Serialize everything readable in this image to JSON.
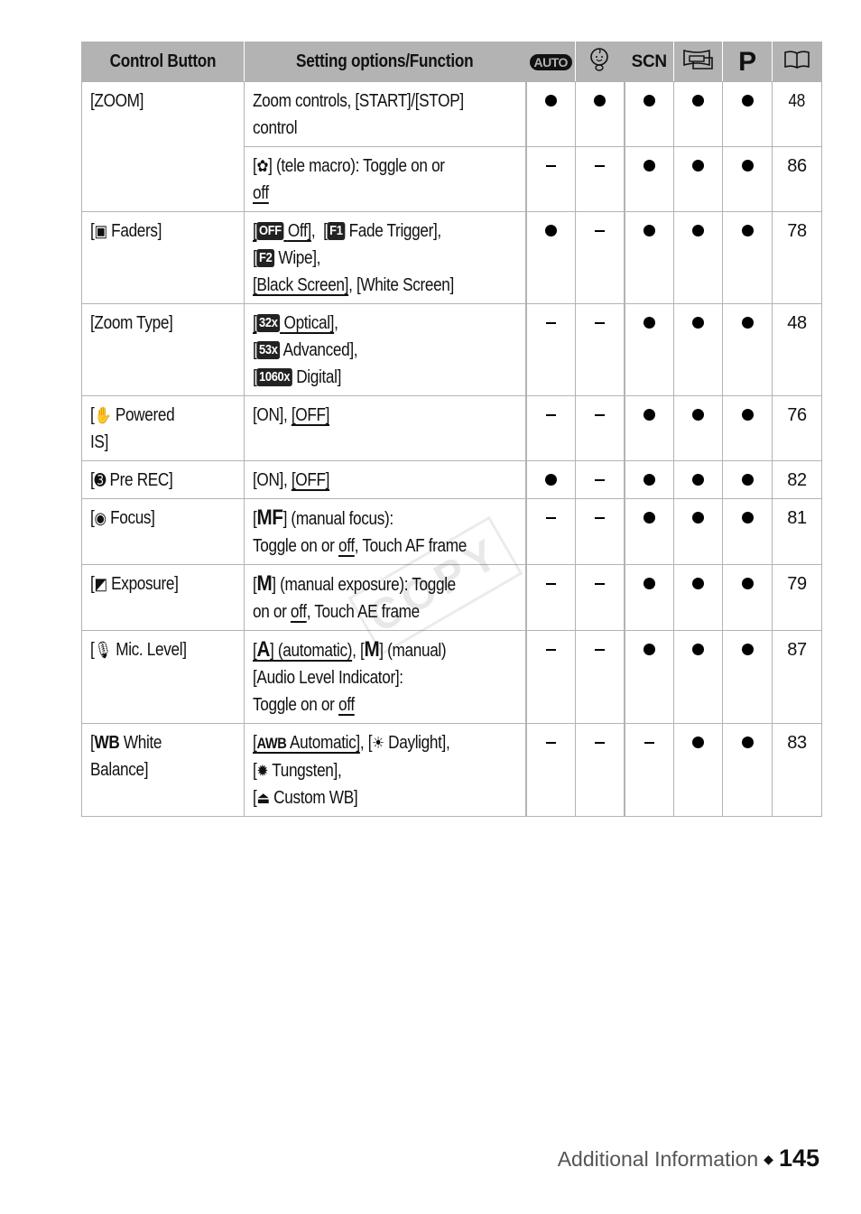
{
  "table": {
    "headers": {
      "control_button": "Control Button",
      "setting": "Setting options/Function",
      "mode_auto": "AUTO",
      "mode_baby": "baby-mode-icon",
      "mode_scn": "SCN",
      "mode_cine": "cinema-mode-icon",
      "mode_p": "P",
      "page_ref": "book-icon"
    },
    "rows": [
      {
        "control": "[ZOOM]",
        "setting_line1": "Zoom controls, [START]/[STOP]",
        "setting_line2": "control",
        "marks": [
          "●",
          "●",
          "●",
          "●",
          "●"
        ],
        "page": "48"
      },
      {
        "control": "",
        "setting_pre": "[",
        "setting_icon": "tele-macro-icon",
        "setting_line1": "] (tele macro): Toggle on or",
        "setting_line2": "off",
        "marks": [
          "–",
          "–",
          "●",
          "●",
          "●"
        ],
        "page": "86"
      },
      {
        "control": "Faders]",
        "control_icon": "faders-icon",
        "options": [
          "OFF Off",
          "F1 Fade Trigger",
          "F2 Wipe",
          "Black Screen",
          "White Screen"
        ],
        "badges": {
          "off": "OFF",
          "f1": "F1",
          "f2": "F2"
        },
        "labels": {
          "off": "Off]",
          "f1": "Fade Trigger],",
          "f2": "Wipe],",
          "black": "[Black Screen]",
          "white": ", [White Screen]"
        },
        "marks": [
          "●",
          "–",
          "●",
          "●",
          "●"
        ],
        "page": "78"
      },
      {
        "control": "[Zoom Type]",
        "badges": {
          "optical": "32x",
          "advanced": "53x",
          "digital": "1060x"
        },
        "labels": {
          "optical": "Optical]",
          "advanced": "Advanced],",
          "digital": "Digital]"
        },
        "marks": [
          "–",
          "–",
          "●",
          "●",
          "●"
        ],
        "page": "48"
      },
      {
        "control_line1": "Powered",
        "control_line2": "IS]",
        "control_icon": "powered-is-icon",
        "setting_on": "[ON], ",
        "setting_off": "[OFF]",
        "marks": [
          "–",
          "–",
          "●",
          "●",
          "●"
        ],
        "page": "76"
      },
      {
        "control": "Pre REC]",
        "control_icon": "pre-rec-icon",
        "setting_on": "[ON], ",
        "setting_off": "[OFF]",
        "marks": [
          "●",
          "–",
          "●",
          "●",
          "●"
        ],
        "page": "82"
      },
      {
        "control": "Focus]",
        "control_icon": "focus-icon",
        "badge": "MF",
        "setting_line1": "] (manual focus):",
        "setting_line2a": "Toggle on or ",
        "setting_line2b": "off",
        "setting_line2c": ", Touch AF frame",
        "marks": [
          "–",
          "–",
          "●",
          "●",
          "●"
        ],
        "page": "81"
      },
      {
        "control": "Exposure]",
        "control_icon": "exposure-icon",
        "badge": "M",
        "setting_line1": "] (manual exposure): Toggle",
        "setting_line2a": "on or ",
        "setting_line2b": "off",
        "setting_line2c": ", Touch AE frame",
        "marks": [
          "–",
          "–",
          "●",
          "●",
          "●"
        ],
        "page": "79"
      },
      {
        "control": "Mic. Level]",
        "control_icon": "microphone-icon",
        "badge_a": "A",
        "badge_m": "M",
        "setting_auto": "] (automatic)",
        "setting_manual": "] (manual)",
        "setting_line2": "[Audio Level Indicator]:",
        "setting_line3a": "Toggle on or ",
        "setting_line3b": "off",
        "marks": [
          "–",
          "–",
          "–",
          "●",
          "●"
        ],
        "marks_actual": [
          "–",
          "–",
          "●",
          "●",
          "●"
        ],
        "page": "87"
      },
      {
        "control_line1": "White",
        "control_line2": "Balance]",
        "control_badge": "WB",
        "awb": "AWB",
        "labels": {
          "auto": "Automatic]",
          "daylight": "Daylight],",
          "tungsten": "Tungsten],",
          "custom": "Custom WB]"
        },
        "marks": [
          "–",
          "–",
          "–",
          "●",
          "●"
        ],
        "page": "83"
      }
    ]
  },
  "watermark": "COPY",
  "footer": {
    "section": "Additional Information",
    "separator": "◆",
    "page_number": "145"
  }
}
